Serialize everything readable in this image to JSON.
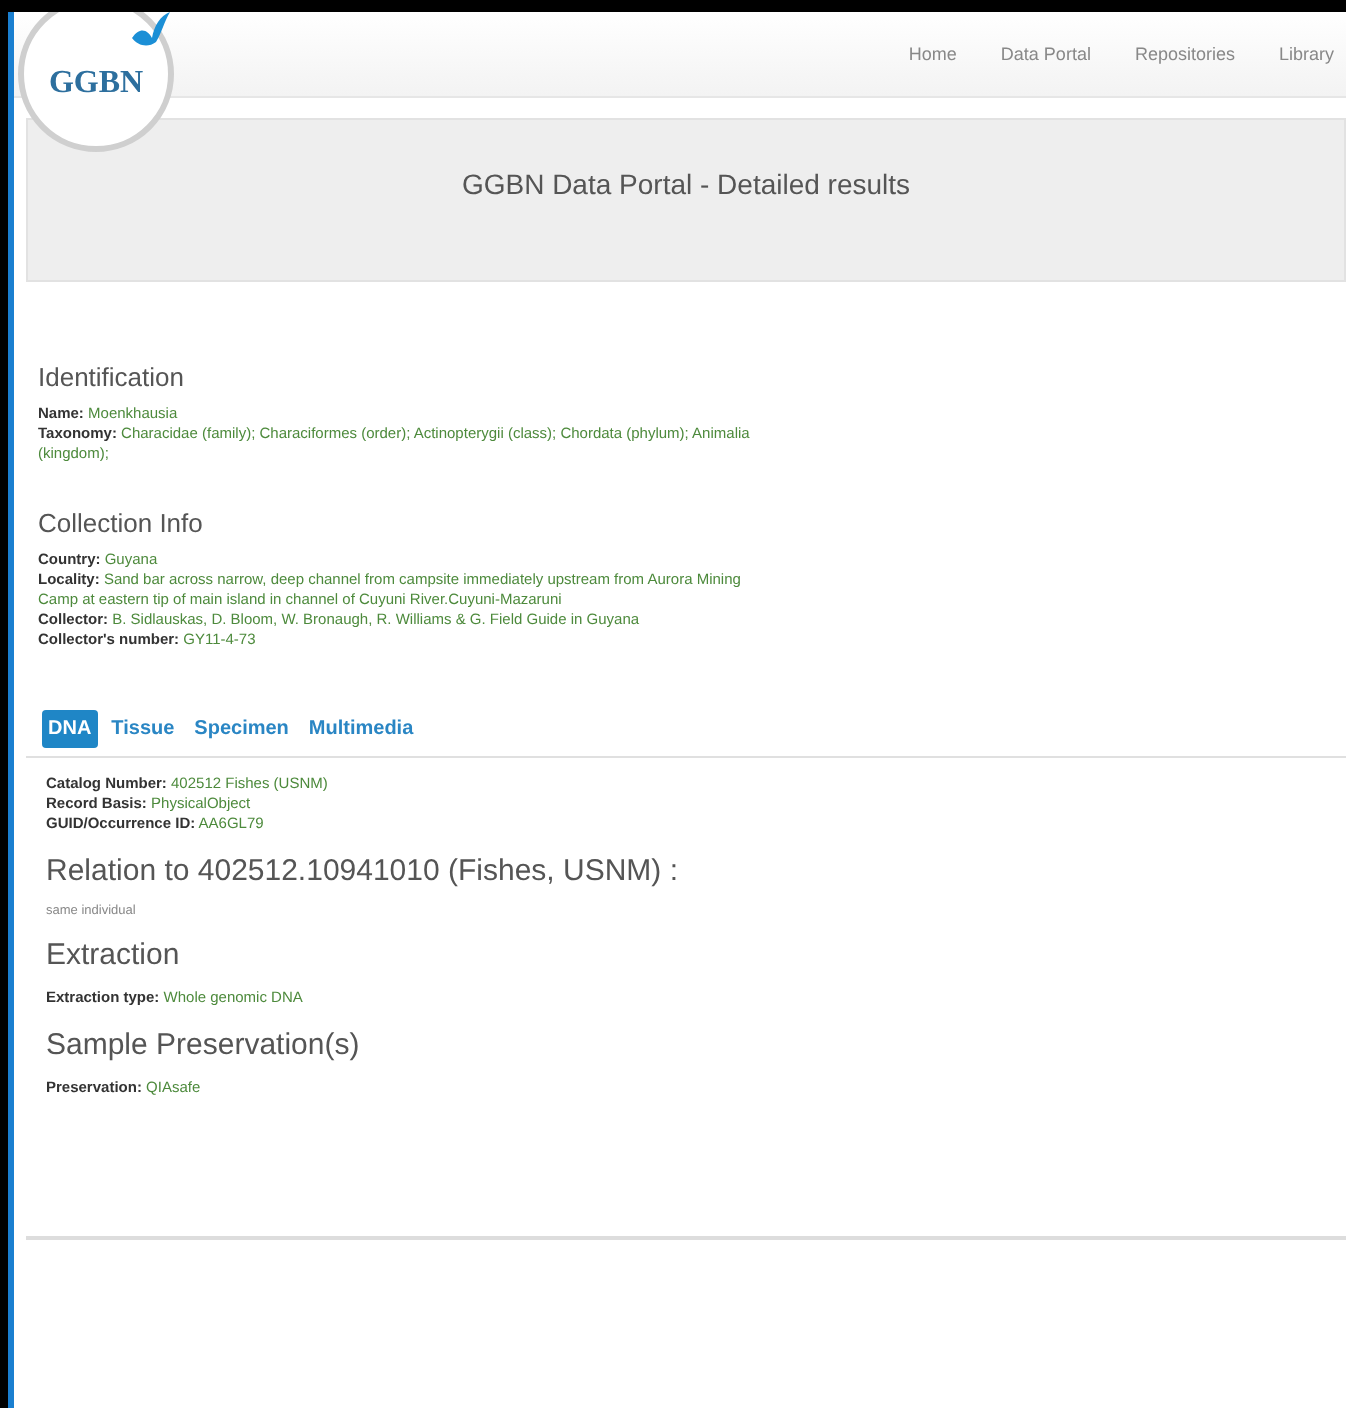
{
  "logo": {
    "text": "GGBN"
  },
  "nav": [
    {
      "label": "Home"
    },
    {
      "label": "Data Portal"
    },
    {
      "label": "Repositories"
    },
    {
      "label": "Library"
    }
  ],
  "header": {
    "title": "GGBN Data Portal - Detailed results"
  },
  "sections": [
    {
      "heading": "Identification",
      "fields": [
        {
          "label": "Name:",
          "value": "Moenkhausia"
        },
        {
          "label": "Taxonomy:",
          "value": "Characidae (family); Characiformes (order); Actinopterygii (class); Chordata (phylum); Animalia (kingdom);"
        }
      ]
    },
    {
      "heading": "Collection Info",
      "fields": [
        {
          "label": "Country:",
          "value": "Guyana"
        },
        {
          "label": "Locality:",
          "value": "Sand bar across narrow, deep channel from campsite immediately upstream from Aurora Mining Camp at eastern tip of main island in channel of Cuyuni River.Cuyuni-Mazaruni"
        },
        {
          "label": "Collector:",
          "value": "B. Sidlauskas, D. Bloom, W. Bronaugh, R. Williams & G. Field Guide in Guyana"
        },
        {
          "label": "Collector's number:",
          "value": "GY11-4-73"
        }
      ]
    }
  ],
  "tabs": [
    {
      "label": "DNA",
      "selected": true
    },
    {
      "label": "Tissue",
      "selected": false
    },
    {
      "label": "Specimen",
      "selected": false
    },
    {
      "label": "Multimedia",
      "selected": false
    }
  ],
  "tab_panel": {
    "fields": [
      {
        "label": "Catalog Number:",
        "value": "402512 Fishes (USNM)"
      },
      {
        "label": "Record Basis:",
        "value": "PhysicalObject"
      },
      {
        "label": "GUID/Occurrence ID:",
        "value": "AA6GL79"
      }
    ],
    "relation": {
      "heading": "Relation to 402512.10941010 (Fishes, USNM) :",
      "note": "same individual"
    },
    "subsections": [
      {
        "heading": "Extraction",
        "fields": [
          {
            "label": "Extraction type:",
            "value": "Whole genomic DNA"
          }
        ]
      },
      {
        "heading": "Sample Preservation(s)",
        "fields": [
          {
            "label": "Preservation:",
            "value": "QIAsafe"
          }
        ]
      }
    ]
  }
}
